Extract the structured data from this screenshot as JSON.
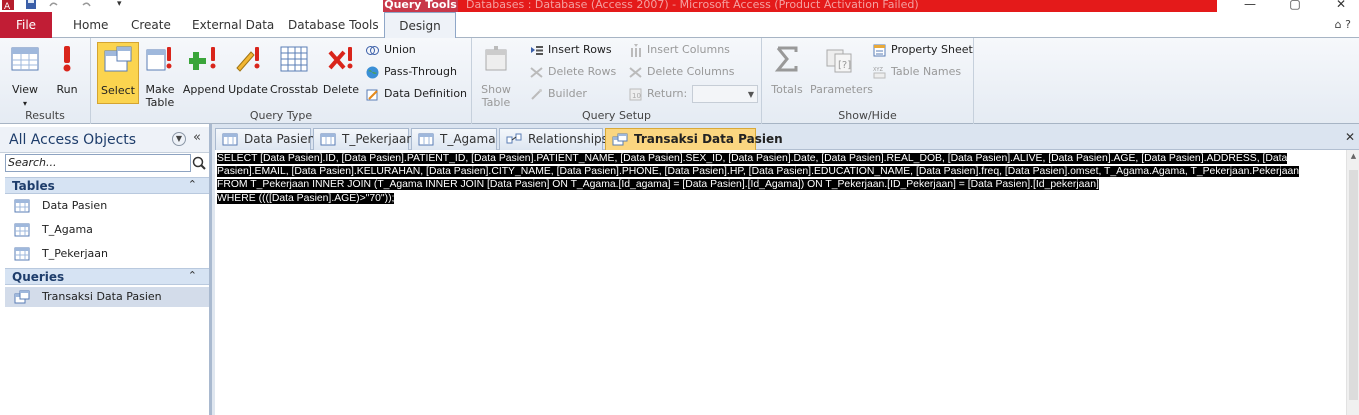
{
  "title_bar": {
    "context_tab": "Query Tools",
    "window_title": "Databases : Database (Access 2007) - Microsoft Access (Product Activation Failed)",
    "min_glyph": "—",
    "max_glyph": "▢",
    "close_glyph": "✕"
  },
  "ribbon_tabs": {
    "file": "File",
    "home": "Home",
    "create": "Create",
    "external_data": "External Data",
    "database_tools": "Database Tools",
    "design": "Design",
    "help_glyph": "⌂ ?"
  },
  "ribbon": {
    "results": {
      "label": "Results",
      "view": "View",
      "run": "Run"
    },
    "query_type": {
      "label": "Query Type",
      "select": "Select",
      "make_table": "Make Table",
      "append": "Append",
      "update": "Update",
      "crosstab": "Crosstab",
      "delete": "Delete",
      "union": "Union",
      "pass_through": "Pass-Through",
      "data_definition": "Data Definition"
    },
    "query_setup": {
      "label": "Query Setup",
      "show_table": "Show Table",
      "insert_rows": "Insert Rows",
      "delete_rows": "Delete Rows",
      "builder": "Builder",
      "insert_columns": "Insert Columns",
      "delete_columns": "Delete Columns",
      "return": "Return:"
    },
    "show_hide": {
      "label": "Show/Hide",
      "totals": "Totals",
      "parameters": "Parameters",
      "property_sheet": "Property Sheet",
      "table_names": "Table Names"
    }
  },
  "nav_pane": {
    "title": "All Access Objects",
    "search_placeholder": "Search...",
    "tables_header": "Tables",
    "tables": [
      "Data Pasien",
      "T_Agama",
      "T_Pekerjaan"
    ],
    "queries_header": "Queries",
    "queries": [
      "Transaksi Data Pasien"
    ]
  },
  "doc_tabs": [
    {
      "label": "Data Pasien",
      "icon": "table-icon"
    },
    {
      "label": "T_Pekerjaan",
      "icon": "table-icon"
    },
    {
      "label": "T_Agama",
      "icon": "table-icon"
    },
    {
      "label": "Relationships",
      "icon": "relationships-icon"
    },
    {
      "label": "Transaksi Data Pasien",
      "icon": "query-icon",
      "active": true
    }
  ],
  "sql": {
    "lines": [
      "SELECT [Data Pasien].ID, [Data Pasien].PATIENT_ID, [Data Pasien].PATIENT_NAME, [Data Pasien].SEX_ID, [Data Pasien].Date, [Data Pasien].REAL_DOB, [Data Pasien].ALIVE, [Data Pasien].AGE, [Data Pasien].ADDRESS, [Data",
      "Pasien].EMAIL, [Data Pasien].KELURAHAN, [Data Pasien].CITY_NAME, [Data Pasien].PHONE, [Data Pasien].HP, [Data Pasien].EDUCATION_NAME, [Data Pasien].freq, [Data Pasien].omset, T_Agama.Agama, T_Pekerjaan.Pekerjaan",
      "FROM T_Pekerjaan INNER JOIN (T_Agama INNER JOIN [Data Pasien] ON T_Agama.[Id_agama] = [Data Pasien].[Id_Agama]) ON T_Pekerjaan.[ID_Pekerjaan] = [Data Pasien].[Id_pekerjaan]",
      "WHERE ((([Data Pasien].AGE)>\"70\"));"
    ]
  },
  "colors": {
    "file_tab": "#c11d35",
    "title_red": "#e41a1a",
    "selected_button": "#fbd44f",
    "active_doc_tab": "#fbd680"
  }
}
